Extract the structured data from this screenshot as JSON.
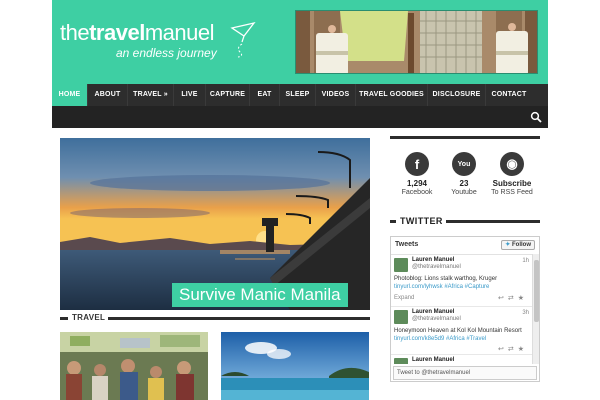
{
  "logo": {
    "line1_a": "the",
    "line1_b": "travel",
    "line1_c": "manuel",
    "tagline": "an endless journey"
  },
  "nav": {
    "items": [
      {
        "label": "HOME",
        "active": true
      },
      {
        "label": "ABOUT"
      },
      {
        "label": "TRAVEL »"
      },
      {
        "label": "LIVE"
      },
      {
        "label": "CAPTURE"
      },
      {
        "label": "EAT"
      },
      {
        "label": "SLEEP"
      },
      {
        "label": "VIDEOS"
      },
      {
        "label": "TRAVEL GOODIES"
      },
      {
        "label": "DISCLOSURE"
      },
      {
        "label": "CONTACT"
      }
    ],
    "search_icon": "search-icon"
  },
  "featured": {
    "caption": "Survive Manic Manila"
  },
  "section": {
    "travel_label": "TRAVEL"
  },
  "social": [
    {
      "icon": "facebook-icon",
      "glyph": "f",
      "count": "1,294",
      "sub": "Facebook"
    },
    {
      "icon": "youtube-icon",
      "glyph": "You",
      "count": "23",
      "sub": "Youtube"
    },
    {
      "icon": "rss-icon",
      "glyph": "◉",
      "count": "Subscribe",
      "sub": "To RSS Feed"
    }
  ],
  "twitter": {
    "heading": "TWITTER",
    "widget_title": "Tweets",
    "follow_label": "Follow",
    "tweets": [
      {
        "name": "Lauren Manuel",
        "handle": "@thetravelmanuel",
        "time": "1h",
        "text": "Photoblog: Lions stalk warthog, Kruger",
        "link": "tinyurl.com/lyhwsk #Africa #Capture",
        "expand": "Expand"
      },
      {
        "name": "Lauren Manuel",
        "handle": "@thetravelmanuel",
        "time": "3h",
        "text": "Honeymoon Heaven at Kol Kol Mountain Resort",
        "link": "tinyurl.com/k8e5d9 #Africa #Travel",
        "expand": ""
      },
      {
        "name": "Lauren Manuel",
        "handle": "",
        "time": "",
        "text": "",
        "link": "",
        "expand": ""
      }
    ],
    "input_placeholder": "Tweet to @thetravelmanuel"
  },
  "colors": {
    "brand": "#3ecfa3",
    "nav": "#2d2d2d",
    "link": "#3a9ac9"
  }
}
